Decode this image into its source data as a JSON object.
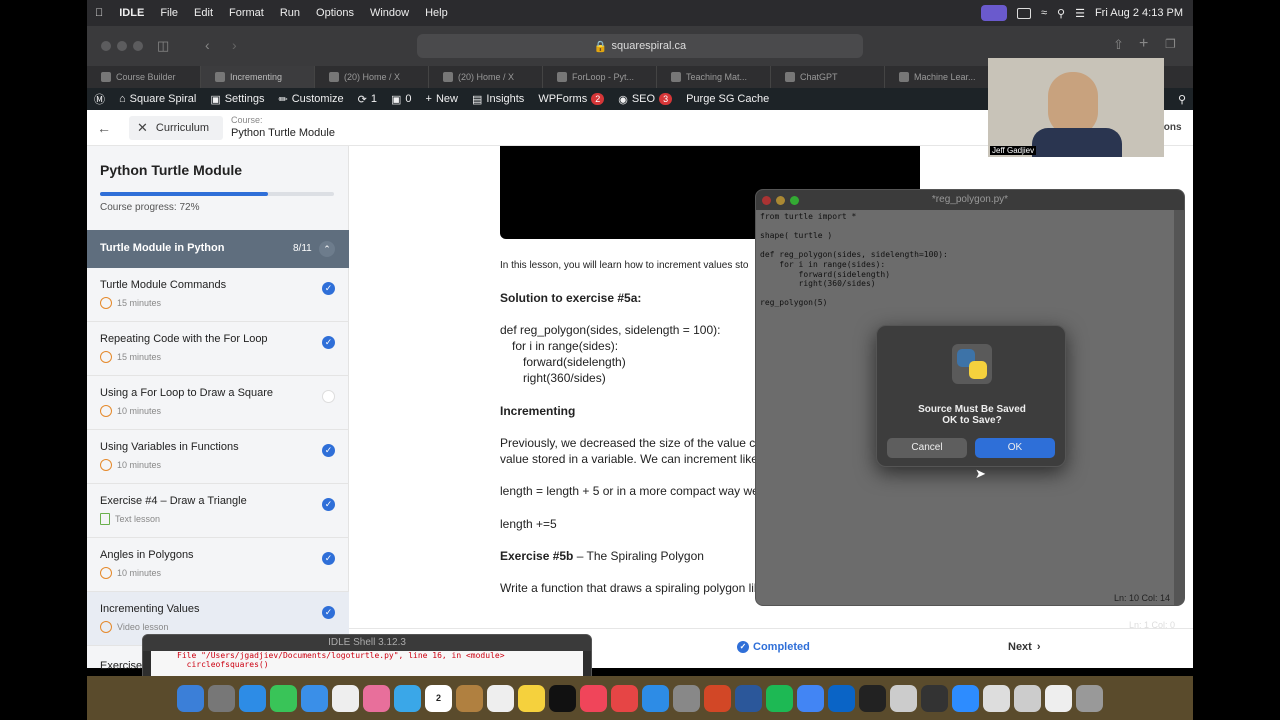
{
  "menubar": {
    "app": "IDLE",
    "items": [
      "File",
      "Edit",
      "Format",
      "Run",
      "Options",
      "Window",
      "Help"
    ],
    "datetime": "Fri Aug 2  4:13 PM"
  },
  "browser": {
    "url": "squarespiral.ca",
    "tabs": [
      "Course Builder",
      "Incrementing",
      "(20) Home / X",
      "(20) Home / X",
      "ForLoop - Pyt...",
      "Teaching Mat...",
      "ChatGPT",
      "Machine Lear..."
    ]
  },
  "wpbar": {
    "site": "Square Spiral",
    "settings": "Settings",
    "customize": "Customize",
    "updates_count": "1",
    "comments_count": "0",
    "new": "New",
    "insights": "Insights",
    "wpforms": "WPForms",
    "wpforms_badge": "2",
    "seo": "SEO",
    "seo_badge": "3",
    "purge": "Purge SG Cache"
  },
  "course_header": {
    "curriculum": "Curriculum",
    "course_label": "Course:",
    "course_name": "Python Turtle Module",
    "right_partial": "ions"
  },
  "sidebar": {
    "title": "Python Turtle Module",
    "progress_percent": 72,
    "progress_text": "Course progress: 72%",
    "section_title": "Turtle Module in Python",
    "section_count": "8/11",
    "lessons": [
      {
        "title": "Turtle Module Commands",
        "meta": "15 minutes",
        "done": true
      },
      {
        "title": "Repeating Code with the For Loop",
        "meta": "15 minutes",
        "done": true
      },
      {
        "title": "Using a For Loop to Draw a Square",
        "meta": "10 minutes",
        "done": false
      },
      {
        "title": "Using Variables in Functions",
        "meta": "10 minutes",
        "done": true
      },
      {
        "title": "Exercise #4 – Draw a Triangle",
        "meta": "Text lesson",
        "done": true
      },
      {
        "title": "Angles in Polygons",
        "meta": "10 minutes",
        "done": true
      },
      {
        "title": "Incrementing Values",
        "meta": "Video lesson",
        "done": true
      }
    ],
    "partial_item": "Exercise"
  },
  "content": {
    "intro": "In this lesson, you will learn how to increment values sto",
    "solution_heading": "Solution to exercise #5a:",
    "code_lines": [
      "def reg_polygon(sides, sidelength = 100):",
      "    for i in range(sides):",
      "        forward(sidelength)",
      "        right(360/sides)"
    ],
    "incrementing_heading": "Incrementing",
    "para1_line1": "Previously, we decreased the size of the value co",
    "para1_line2": "value stored in a variable. We can increment like t",
    "para2": "length = length + 5 or in a more compact way we",
    "para3": "length +=5",
    "exercise_bold": "Exercise #5b",
    "exercise_rest": " – The Spiraling Polygon",
    "para4": "Write a function that draws a spiraling polygon lik",
    "completed": "Completed",
    "next": "Next"
  },
  "idle": {
    "title": "*reg_polygon.py*",
    "code": "from turtle import *\n\nshape( turtle )\n\ndef reg_polygon(sides, sidelength=100):\n    for i in range(sides):\n        forward(sidelength)\n        right(360/sides)\n\nreg_polygon(5)",
    "status": "Ln: 10   Col: 14",
    "status2": "Ln: 1   Col: 0"
  },
  "dialog": {
    "line1": "Source Must Be Saved",
    "line2": "OK to Save?",
    "cancel": "Cancel",
    "ok": "OK"
  },
  "shell": {
    "title": "IDLE Shell 3.12.3",
    "line1": "File \"/Users/jgadjiev/Documents/logoturtle.py\", line 16, in <module>",
    "line2": "  circleofsquares()"
  },
  "webcam": {
    "name": "Jeff Gadjiev"
  },
  "colors": {
    "accent": "#2f6fd8",
    "section_bg": "#5f6e7e",
    "wp_bar": "#1d2327",
    "clock": "#e58a2c"
  }
}
